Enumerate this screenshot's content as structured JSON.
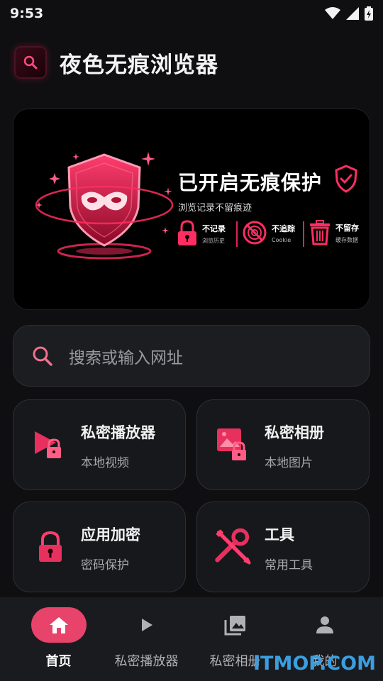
{
  "status_bar": {
    "time": "9:53"
  },
  "header": {
    "title": "夜色无痕浏览器"
  },
  "hero": {
    "title": "已开启无痕保护",
    "subtitle": "浏览记录不留痕迹",
    "features": [
      {
        "name": "不记录",
        "desc": "浏览历史"
      },
      {
        "name": "不追踪",
        "desc": "Cookie"
      },
      {
        "name": "不留存",
        "desc": "缓存数据"
      }
    ]
  },
  "search": {
    "placeholder": "搜索或输入网址"
  },
  "cards": [
    {
      "title": "私密播放器",
      "subtitle": "本地视频",
      "icon": "video-lock-icon"
    },
    {
      "title": "私密相册",
      "subtitle": "本地图片",
      "icon": "photo-lock-icon"
    },
    {
      "title": "应用加密",
      "subtitle": "密码保护",
      "icon": "lock-icon"
    },
    {
      "title": "工具",
      "subtitle": "常用工具",
      "icon": "tools-icon"
    }
  ],
  "bottom_nav": [
    {
      "label": "首页",
      "icon": "home-icon",
      "active": true
    },
    {
      "label": "私密播放器",
      "icon": "play-icon",
      "active": false
    },
    {
      "label": "私密相册",
      "icon": "photo-library-icon",
      "active": false
    },
    {
      "label": "我的",
      "icon": "person-icon",
      "active": false
    }
  ],
  "watermark": "ITMOP.COM",
  "colors": {
    "accent": "#e8436a",
    "background": "#0f0f11",
    "card": "#17181b"
  }
}
